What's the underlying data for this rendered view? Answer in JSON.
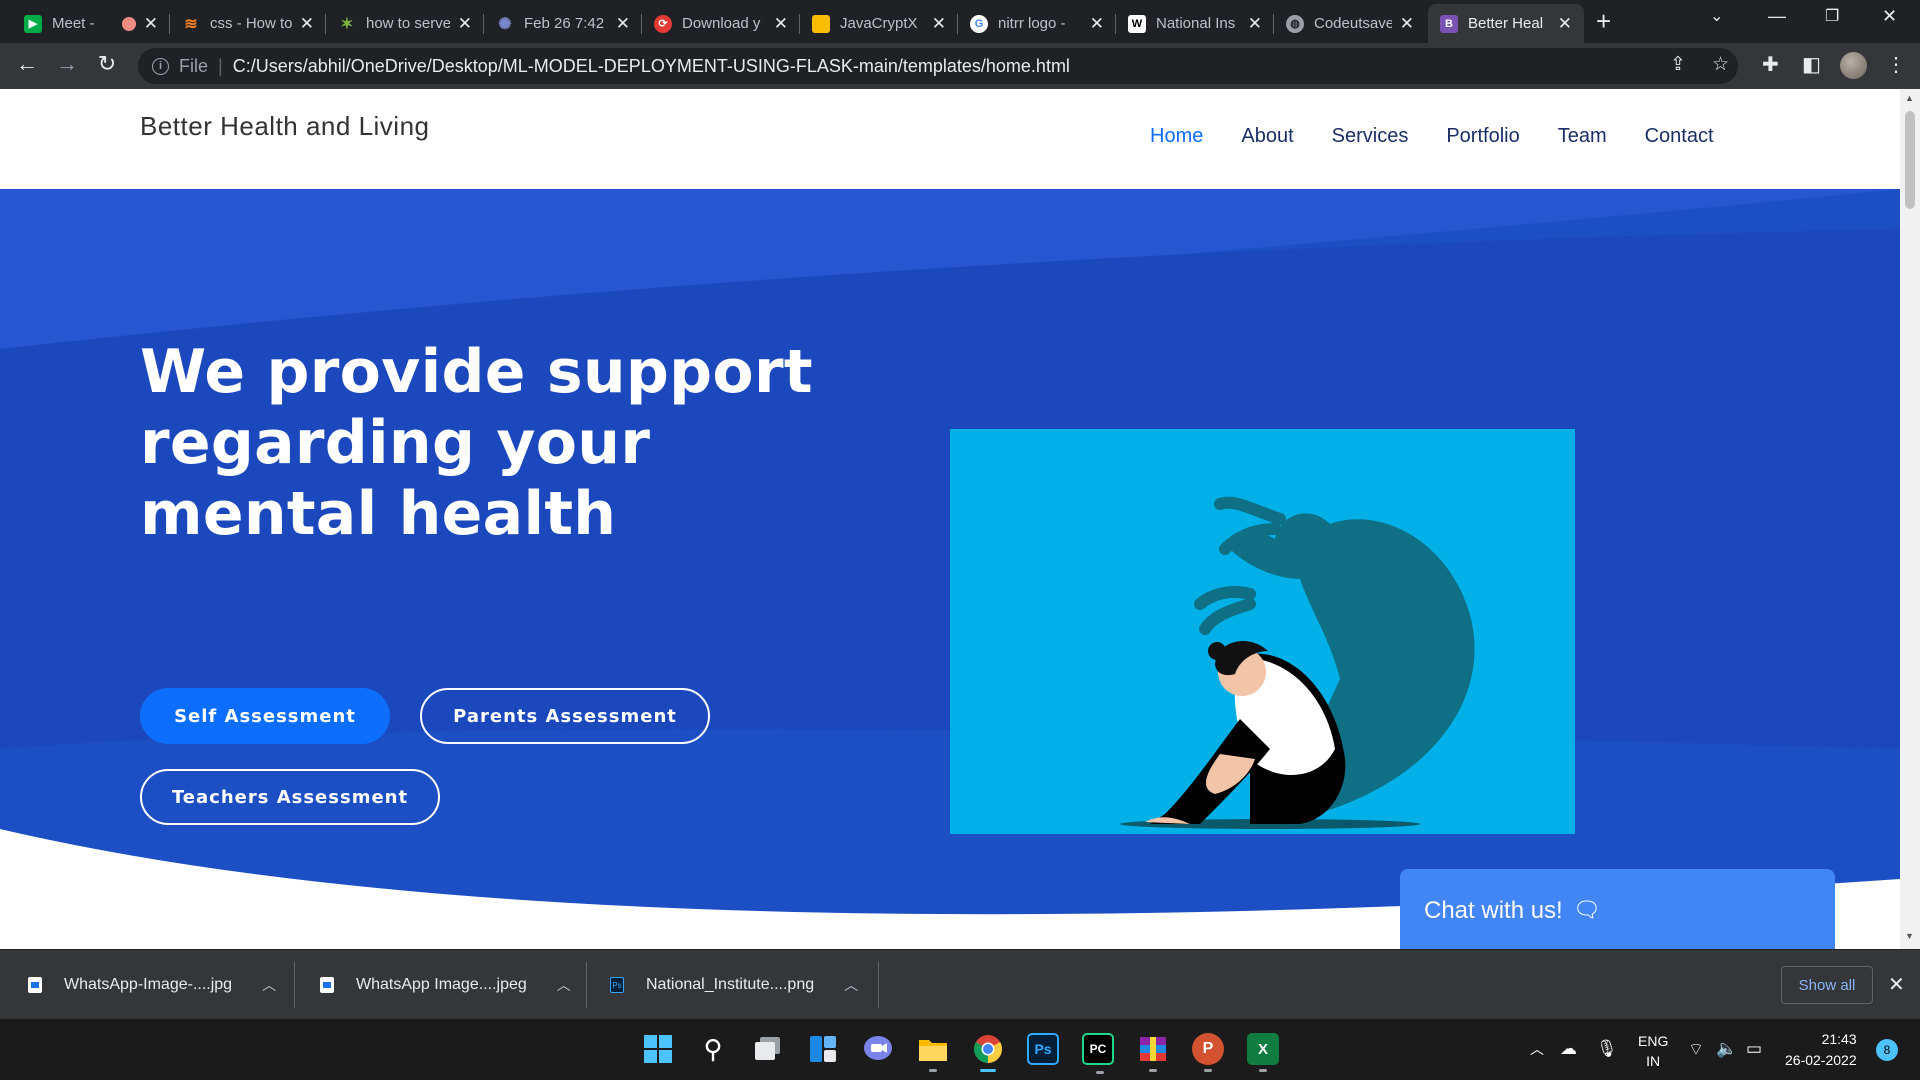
{
  "browser": {
    "tabs": [
      {
        "title": "Meet -",
        "icon": "google-meet-icon",
        "color": "#00ac47",
        "recording": true
      },
      {
        "title": "css - How to",
        "icon": "stackoverflow-icon",
        "color": "#f48024"
      },
      {
        "title": "how to serve",
        "icon": "sparkle-icon",
        "color": "#7cb342"
      },
      {
        "title": "Feb 26 7:42",
        "icon": "jamboard-icon",
        "color": "#3f51b5"
      },
      {
        "title": "Download y",
        "icon": "download-site-icon",
        "color": "#e53935"
      },
      {
        "title": "JavaCryptX",
        "icon": "slides-icon",
        "color": "#fbbc04"
      },
      {
        "title": "nitrr logo -",
        "icon": "google-icon",
        "color": "#ffffff"
      },
      {
        "title": "National Ins",
        "icon": "wikipedia-icon",
        "color": "#ffffff"
      },
      {
        "title": "Codeutsave",
        "icon": "globe-icon",
        "color": "#9aa0a6"
      },
      {
        "title": "Better Heal",
        "icon": "bootstrap-icon",
        "color": "#7952b3",
        "active": true
      }
    ],
    "address": {
      "scheme": "File",
      "url": "C:/Users/abhil/OneDrive/Desktop/ML-MODEL-DEPLOYMENT-USING-FLASK-main/templates/home.html"
    }
  },
  "site": {
    "brand": "Better Health and Living",
    "nav": [
      "Home",
      "About",
      "Services",
      "Portfolio",
      "Team",
      "Contact"
    ],
    "active_nav": "Home",
    "hero": {
      "heading": "We provide support regarding your mental health",
      "buttons": {
        "self": "Self Assessment",
        "parents": "Parents Assessment",
        "teachers": "Teachers Assessment"
      }
    },
    "chat_label": "Chat with us!",
    "colors": {
      "hero_bg": "#1d4fc4",
      "primary": "#0d6efd",
      "illustration_bg": "#00b0e6",
      "chat": "#4285f4"
    }
  },
  "downloads": {
    "items": [
      "WhatsApp-Image-....jpg",
      "WhatsApp Image....jpeg",
      "National_Institute....png"
    ],
    "show_all": "Show all"
  },
  "taskbar": {
    "language": "ENG",
    "region": "IN",
    "time": "21:43",
    "date": "26-02-2022",
    "notifications": "8",
    "pinned_apps": [
      "windows-start-icon",
      "search-icon",
      "task-view-icon",
      "widgets-icon",
      "teams-chat-icon",
      "file-explorer-icon",
      "chrome-icon",
      "photoshop-icon",
      "pycharm-icon",
      "winrar-icon",
      "powerpoint-icon",
      "excel-icon"
    ],
    "pinned_labels": {
      "photoshop": "Ps",
      "pycharm": "PC",
      "powerpoint": "P",
      "excel": "X"
    }
  }
}
